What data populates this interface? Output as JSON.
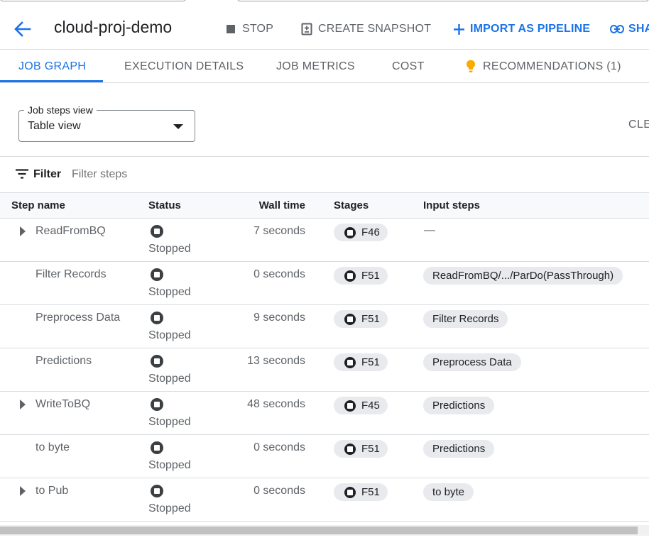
{
  "header": {
    "title": "cloud-proj-demo",
    "stop_label": "STOP",
    "snapshot_label": "CREATE SNAPSHOT",
    "import_label": "IMPORT AS PIPELINE",
    "share_label": "SHA",
    "accent_color": "#1a73e8"
  },
  "tabs": [
    {
      "label": "JOB GRAPH",
      "active": true
    },
    {
      "label": "EXECUTION DETAILS",
      "active": false
    },
    {
      "label": "JOB METRICS",
      "active": false
    },
    {
      "label": "COST",
      "active": false
    },
    {
      "label": "RECOMMENDATIONS (1)",
      "active": false,
      "icon": "lightbulb-icon",
      "icon_color": "#f9ab00"
    }
  ],
  "view_select": {
    "label": "Job steps view",
    "value": "Table view"
  },
  "clear_label": "CLE",
  "filter": {
    "label": "Filter",
    "placeholder": "Filter steps"
  },
  "table": {
    "headers": {
      "step_name": "Step name",
      "status": "Status",
      "wall_time": "Wall time",
      "stages": "Stages",
      "input_steps": "Input steps"
    },
    "rows": [
      {
        "name": "ReadFromBQ",
        "expandable": true,
        "status": "Stopped",
        "wall_time": "7 seconds",
        "stage": "F46",
        "input": "—",
        "input_is_chip": false
      },
      {
        "name": "Filter Records",
        "expandable": false,
        "status": "Stopped",
        "wall_time": "0 seconds",
        "stage": "F51",
        "input": "ReadFromBQ/.../ParDo(PassThrough)",
        "input_is_chip": true
      },
      {
        "name": "Preprocess Data",
        "expandable": false,
        "status": "Stopped",
        "wall_time": "9 seconds",
        "stage": "F51",
        "input": "Filter Records",
        "input_is_chip": true
      },
      {
        "name": "Predictions",
        "expandable": false,
        "status": "Stopped",
        "wall_time": "13 seconds",
        "stage": "F51",
        "input": "Preprocess Data",
        "input_is_chip": true
      },
      {
        "name": "WriteToBQ",
        "expandable": true,
        "status": "Stopped",
        "wall_time": "48 seconds",
        "stage": "F45",
        "input": "Predictions",
        "input_is_chip": true
      },
      {
        "name": "to byte",
        "expandable": false,
        "status": "Stopped",
        "wall_time": "0 seconds",
        "stage": "F51",
        "input": "Predictions",
        "input_is_chip": true
      },
      {
        "name": "to Pub",
        "expandable": true,
        "status": "Stopped",
        "wall_time": "0 seconds",
        "stage": "F51",
        "input": "to byte",
        "input_is_chip": true
      }
    ]
  }
}
